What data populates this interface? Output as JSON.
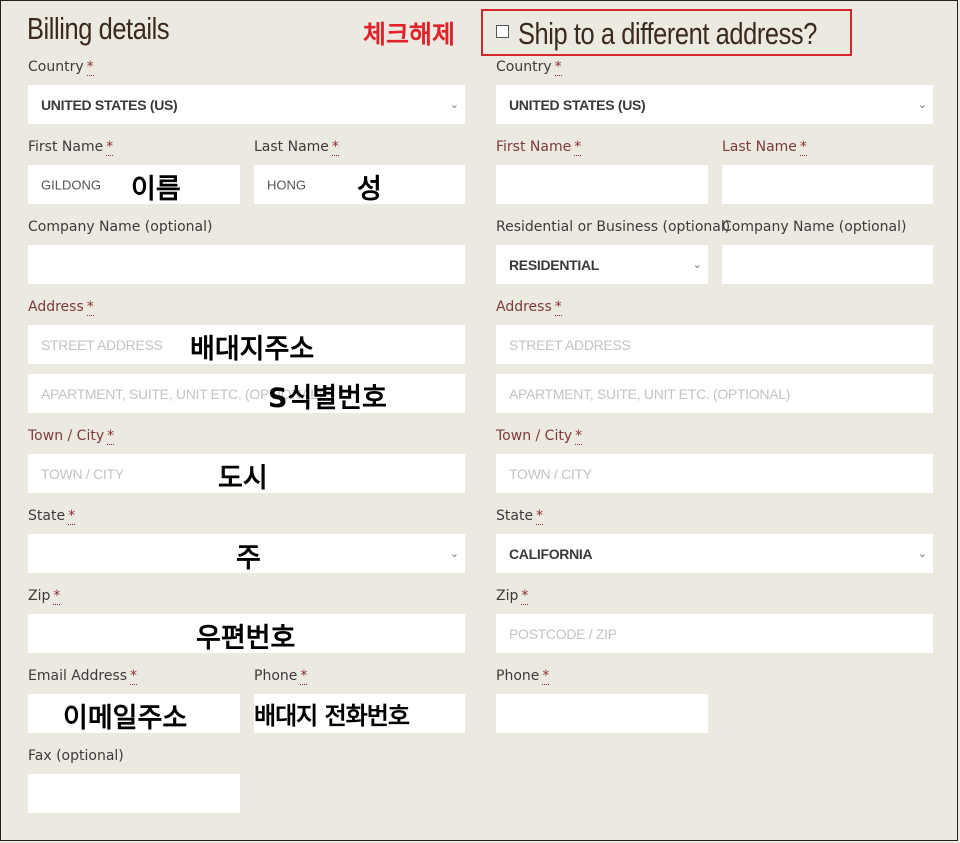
{
  "billing": {
    "title": "Billing details",
    "country_label": "Country",
    "country_value": "UNITED STATES (US)",
    "first_name_label": "First Name",
    "first_name_value": "GILDONG",
    "last_name_label": "Last Name",
    "last_name_value": "HONG",
    "company_label": "Company Name (optional)",
    "address_label": "Address",
    "street_placeholder": "STREET ADDRESS",
    "apartment_placeholder": "APARTMENT, SUITE, UNIT ETC. (OPTIONAL)",
    "town_label": "Town / City",
    "town_placeholder": "TOWN / CITY",
    "state_label": "State",
    "zip_label": "Zip",
    "email_label": "Email Address",
    "phone_label": "Phone",
    "fax_label": "Fax (optional)"
  },
  "shipping": {
    "checkbox_label": "Ship to a different address?",
    "country_label": "Country",
    "country_value": "UNITED STATES (US)",
    "first_name_label": "First Name",
    "last_name_label": "Last Name",
    "residential_label": "Residential or Business (optional)",
    "residential_value": "RESIDENTIAL",
    "company_label": "Company Name (optional)",
    "address_label": "Address",
    "street_placeholder": "STREET ADDRESS",
    "apartment_placeholder": "APARTMENT, SUITE, UNIT ETC. (OPTIONAL)",
    "town_label": "Town / City",
    "town_placeholder": "TOWN / CITY",
    "state_label": "State",
    "state_value": "CALIFORNIA",
    "zip_label": "Zip",
    "zip_placeholder": "POSTCODE / ZIP",
    "phone_label": "Phone"
  },
  "required_mark": "*",
  "annotations": {
    "uncheck": "체크해제",
    "name": "이름",
    "surname": "성",
    "address": "배대지주소",
    "s_id": "S식별번호",
    "city": "도시",
    "state": "주",
    "zip": "우편번호",
    "email": "이메일주소",
    "phone": "배대지 전화번호"
  },
  "colors": {
    "background": "#ece9e0",
    "annotation_red": "#e0222b",
    "required_star": "#8b3030"
  }
}
